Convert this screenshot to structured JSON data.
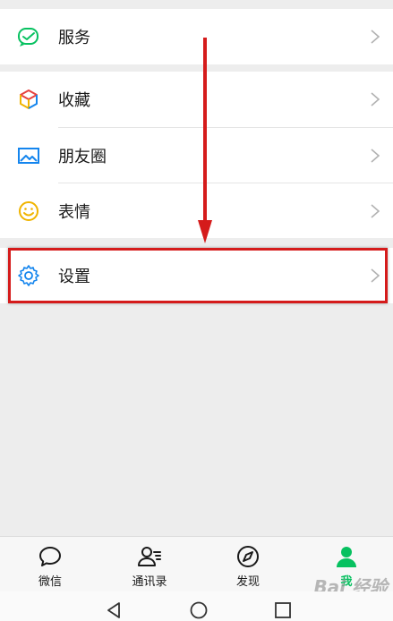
{
  "menu": {
    "service_label": "服务",
    "favorites_label": "收藏",
    "moments_label": "朋友圈",
    "stickers_label": "表情",
    "settings_label": "设置"
  },
  "tabbar": {
    "chats": "微信",
    "contacts": "通讯录",
    "discover": "发现",
    "me": "我"
  },
  "watermark": "Bai 经验",
  "colors": {
    "accent_green": "#07c160",
    "highlight_red": "#d51b1b",
    "background": "#ededed"
  }
}
